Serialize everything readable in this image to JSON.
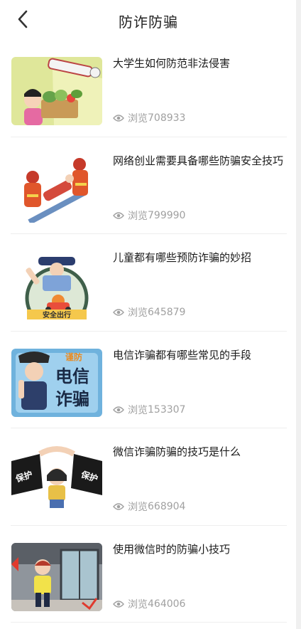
{
  "header": {
    "title": "防诈防骗",
    "back_icon": "chevron-left-icon"
  },
  "articles": [
    {
      "title": "大学生如何防范非法侵害",
      "views_label": "浏览",
      "views": "708933"
    },
    {
      "title": "网络创业需要具备哪些防骗安全技巧",
      "views_label": "浏览",
      "views": "799990"
    },
    {
      "title": "儿童都有哪些预防诈骗的妙招",
      "views_label": "浏览",
      "views": "645879",
      "thumb_text": "安全出行"
    },
    {
      "title": "电信诈骗都有哪些常见的手段",
      "views_label": "浏览",
      "views": "153307",
      "thumb_text_top": "谨防",
      "thumb_text_1": "电信",
      "thumb_text_2": "诈骗"
    },
    {
      "title": "微信诈骗防骗的技巧是什么",
      "views_label": "浏览",
      "views": "668904",
      "thumb_text_left": "保护",
      "thumb_text_right": "保护"
    },
    {
      "title": "使用微信时的防骗小技巧",
      "views_label": "浏览",
      "views": "464006"
    }
  ],
  "colors": {
    "text": "#1a1a1a",
    "meta": "#a0a0a0",
    "divider": "#eeeeee"
  }
}
